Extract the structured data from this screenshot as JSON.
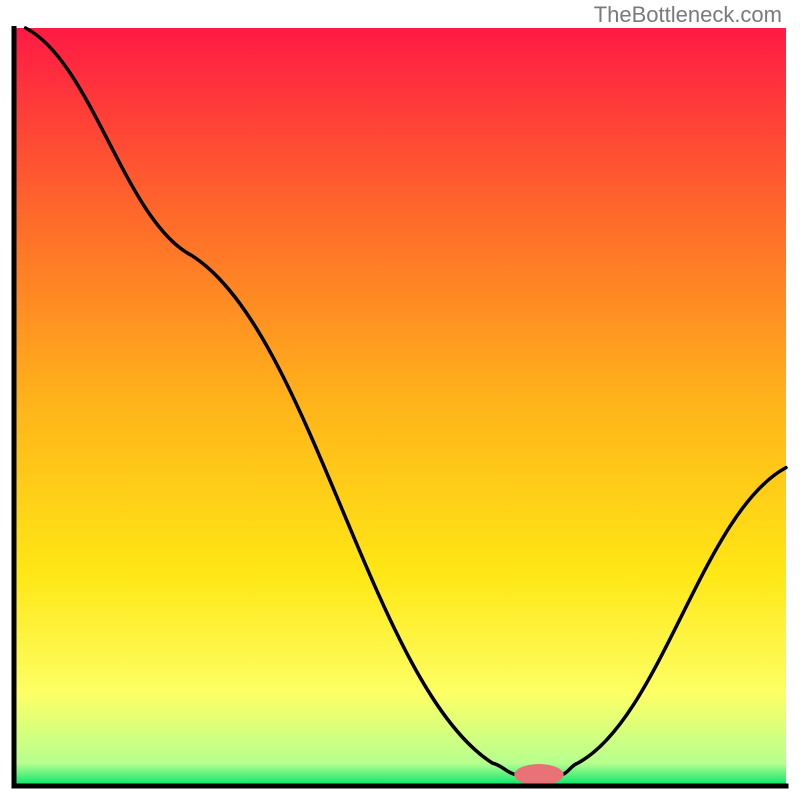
{
  "watermark": "TheBottleneck.com",
  "chart_data": {
    "type": "line",
    "title": "",
    "xlabel": "",
    "ylabel": "",
    "xlim": [
      0,
      100
    ],
    "ylim": [
      0,
      100
    ],
    "background_gradient": {
      "stops": [
        {
          "offset": 0.0,
          "color": "#ff1a44"
        },
        {
          "offset": 0.25,
          "color": "#ff6a2a"
        },
        {
          "offset": 0.5,
          "color": "#ffb51a"
        },
        {
          "offset": 0.72,
          "color": "#ffe715"
        },
        {
          "offset": 0.88,
          "color": "#fcff66"
        },
        {
          "offset": 0.97,
          "color": "#b6ff8f"
        },
        {
          "offset": 1.0,
          "color": "#00e56a"
        }
      ]
    },
    "curve": [
      {
        "x": 1.5,
        "y": 100
      },
      {
        "x": 23,
        "y": 70
      },
      {
        "x": 62,
        "y": 3
      },
      {
        "x": 65,
        "y": 1.5
      },
      {
        "x": 71,
        "y": 1.5
      },
      {
        "x": 73,
        "y": 3
      },
      {
        "x": 100,
        "y": 42
      }
    ],
    "marker": {
      "x": 68,
      "y": 1.5,
      "color": "#e87276",
      "rx": 3.2,
      "ry": 1.4
    },
    "axis_color": "#000000",
    "axis_width": 5
  }
}
